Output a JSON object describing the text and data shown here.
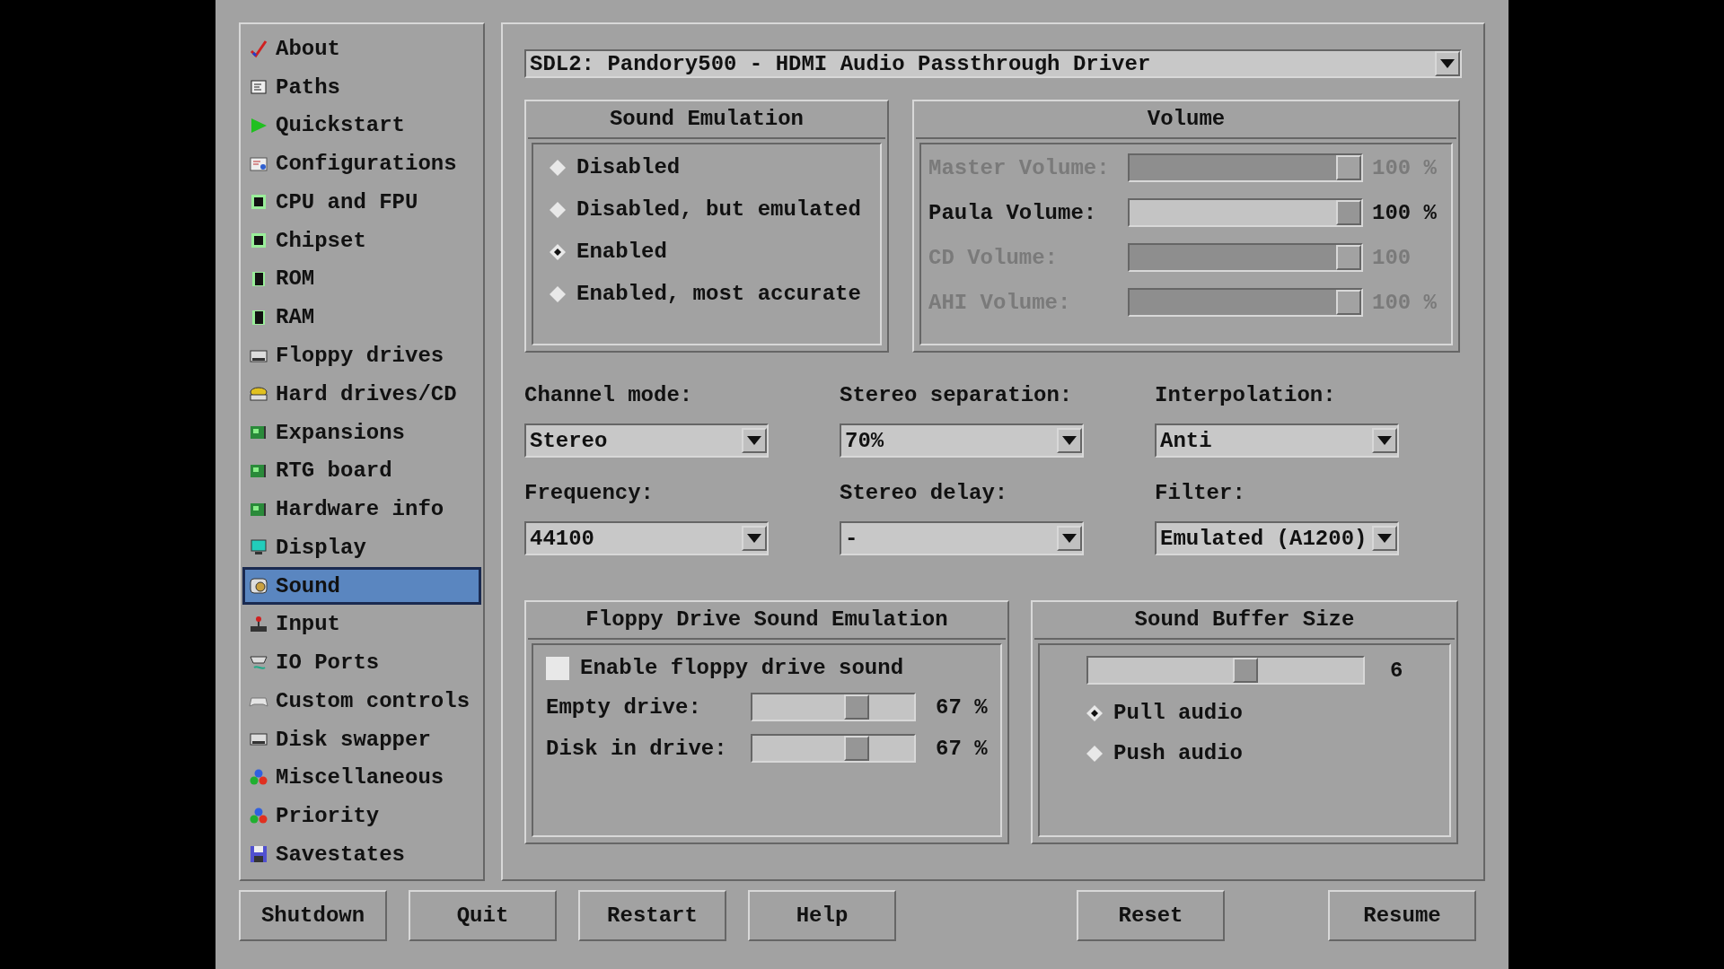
{
  "sidebar": {
    "items": [
      {
        "label": "About",
        "selected": false
      },
      {
        "label": "Paths",
        "selected": false
      },
      {
        "label": "Quickstart",
        "selected": false
      },
      {
        "label": "Configurations",
        "selected": false
      },
      {
        "label": "CPU and FPU",
        "selected": false
      },
      {
        "label": "Chipset",
        "selected": false
      },
      {
        "label": "ROM",
        "selected": false
      },
      {
        "label": "RAM",
        "selected": false
      },
      {
        "label": "Floppy drives",
        "selected": false
      },
      {
        "label": "Hard drives/CD",
        "selected": false
      },
      {
        "label": "Expansions",
        "selected": false
      },
      {
        "label": "RTG board",
        "selected": false
      },
      {
        "label": "Hardware info",
        "selected": false
      },
      {
        "label": "Display",
        "selected": false
      },
      {
        "label": "Sound",
        "selected": true
      },
      {
        "label": "Input",
        "selected": false
      },
      {
        "label": "IO Ports",
        "selected": false
      },
      {
        "label": "Custom controls",
        "selected": false
      },
      {
        "label": "Disk swapper",
        "selected": false
      },
      {
        "label": "Miscellaneous",
        "selected": false
      },
      {
        "label": "Priority",
        "selected": false
      },
      {
        "label": "Savestates",
        "selected": false
      }
    ]
  },
  "device_dropdown": {
    "value": "SDL2: Pandory500 - HDMI Audio Passthrough Driver"
  },
  "sound_emulation": {
    "title": "Sound Emulation",
    "options": [
      {
        "label": "Disabled",
        "selected": false
      },
      {
        "label": "Disabled, but emulated",
        "selected": false
      },
      {
        "label": "Enabled",
        "selected": true
      },
      {
        "label": "Enabled, most accurate",
        "selected": false
      }
    ]
  },
  "volume": {
    "title": "Volume",
    "rows": [
      {
        "label": "Master Volume:",
        "level": 1,
        "reading": "100 %",
        "disabled": true
      },
      {
        "label": "Paula Volume:",
        "level": 1,
        "reading": "100 %",
        "disabled": false
      },
      {
        "label": "CD Volume:",
        "level": 1,
        "reading": "100",
        "disabled": true
      },
      {
        "label": "AHI Volume:",
        "level": 1,
        "reading": "100 %",
        "disabled": true
      }
    ]
  },
  "settings": [
    {
      "label": "Channel mode:",
      "value": "Stereo"
    },
    {
      "label": "Stereo separation:",
      "value": "70%"
    },
    {
      "label": "Interpolation:",
      "value": "Anti"
    },
    {
      "label": "Frequency:",
      "value": "44100"
    },
    {
      "label": "Stereo delay:",
      "value": "-"
    },
    {
      "label": "Filter:",
      "value": "Emulated (A1200)"
    }
  ],
  "floppy_sound": {
    "title": "Floppy Drive Sound Emulation",
    "enable": {
      "label": "Enable floppy drive sound",
      "checked": false
    },
    "rows": [
      {
        "label": "Empty drive:",
        "level": 0.67,
        "reading": "67 %"
      },
      {
        "label": "Disk in drive:",
        "level": 0.67,
        "reading": "67 %"
      }
    ]
  },
  "buffer": {
    "title": "Sound Buffer Size",
    "level": 0.58,
    "reading": "6",
    "options": [
      {
        "label": "Pull audio",
        "selected": true
      },
      {
        "label": "Push audio",
        "selected": false
      }
    ]
  },
  "buttons_left": [
    "Shutdown",
    "Quit",
    "Restart",
    "Help"
  ],
  "buttons_right": [
    "Reset",
    "Resume"
  ]
}
